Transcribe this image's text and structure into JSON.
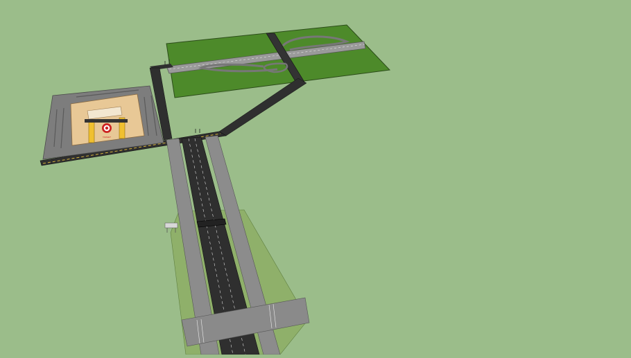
{
  "scene": {
    "background": "#9bbd8a",
    "ground_green": "#4d8a2a",
    "lawn_green": "#8fb06a",
    "asphalt": "#3a3a3a",
    "concrete": "#8c8c8c",
    "lot_gray": "#7d7d7d",
    "building_tan": "#e8c896",
    "accent_yellow": "#f0c030",
    "logo_red": "#cc2222"
  },
  "store": {
    "sign_text": "TARGET"
  }
}
